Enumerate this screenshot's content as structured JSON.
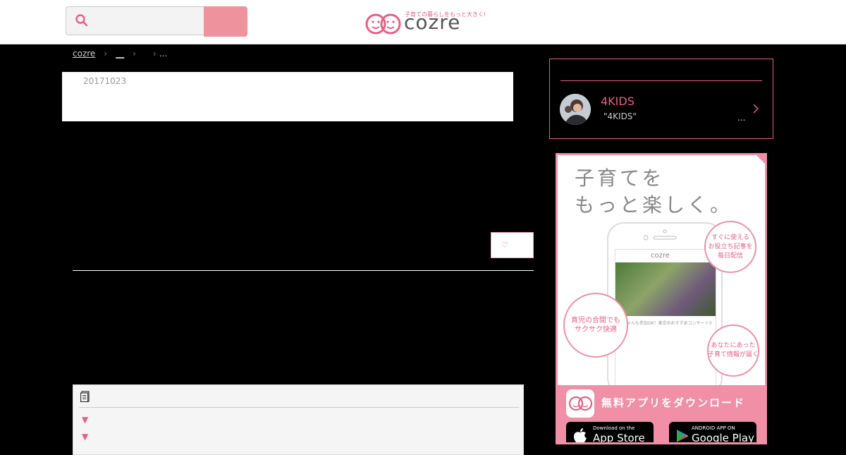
{
  "header": {
    "search": {
      "placeholder": "",
      "button_label": ""
    },
    "logo": {
      "text": "cozre",
      "tagline": "子育ての暮らしをもっと大きく!"
    }
  },
  "breadcrumb": {
    "items": [
      "cozre",
      "__",
      "",
      "..."
    ]
  },
  "article": {
    "date": "20171023",
    "toc": {
      "items": [
        "▼",
        "▼"
      ]
    }
  },
  "sidebar": {
    "writer": {
      "name": "4KIDS",
      "description": "\"4KIDS\"",
      "more": "..."
    },
    "ad": {
      "headline": "子育てを\nもっと楽しく。",
      "ribbon": "無料",
      "bubbles": [
        "すぐに使える\nお役立ち記事を\n毎日配信",
        "育児の合間でも\nサクサク快適",
        "あなたにあった\n子育て情報が届く"
      ],
      "phone_logo": "cozre",
      "phone_text": "赤ちゃんも参加OK！東京のおすすめコンサート3選",
      "cta": "無料アプリをダウンロード",
      "stores": [
        {
          "small": "Download on the",
          "big": "App Store"
        },
        {
          "small": "ANDROID APP ON",
          "big": "Google Play"
        }
      ]
    }
  },
  "colors": {
    "accent": "#e85f84",
    "search_button": "#ee929d",
    "ad_pink": "#f08fa6"
  }
}
